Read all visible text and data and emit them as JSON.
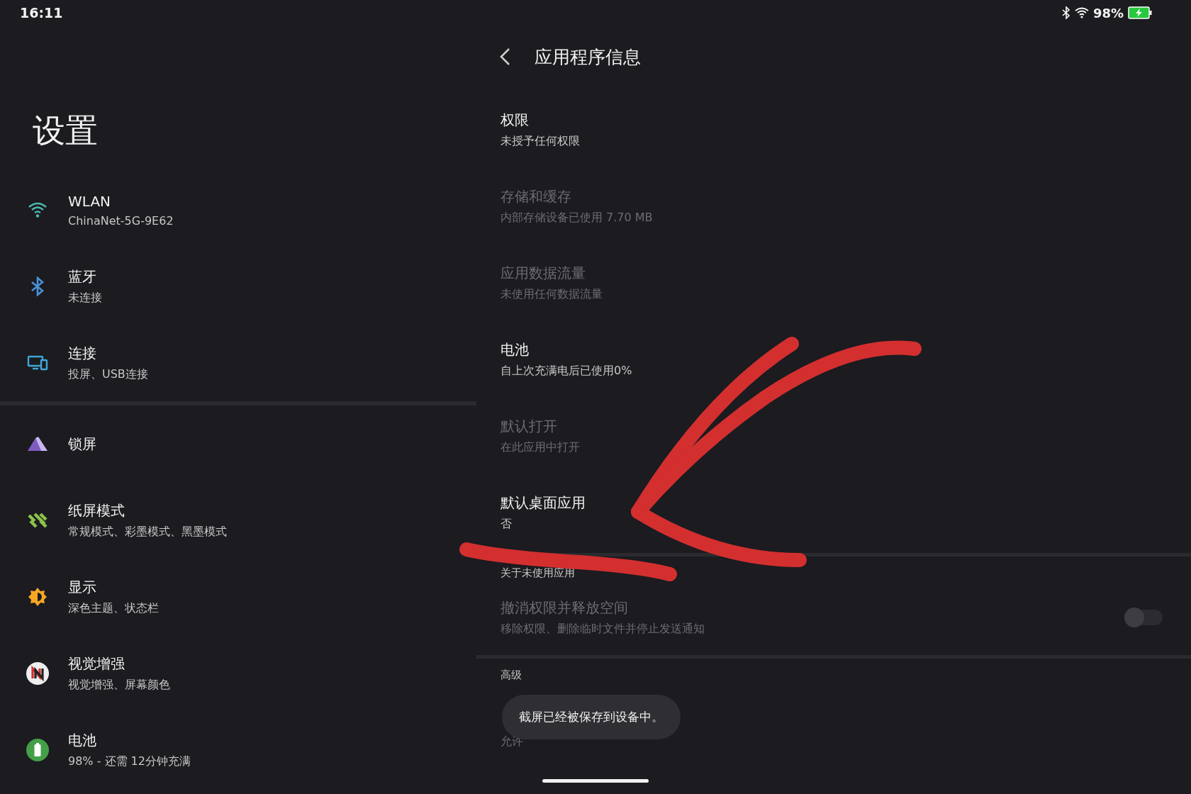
{
  "status_bar": {
    "time": "16:11",
    "battery_text": "98%"
  },
  "settings": {
    "title": "设置",
    "groups": [
      [
        {
          "kind": "wifi",
          "title": "WLAN",
          "subtitle": "ChinaNet-5G-9E62"
        },
        {
          "kind": "bluetooth",
          "title": "蓝牙",
          "subtitle": "未连接"
        },
        {
          "kind": "connection",
          "title": "连接",
          "subtitle": "投屏、USB连接"
        }
      ],
      [
        {
          "kind": "lock",
          "title": "锁屏"
        },
        {
          "kind": "paper",
          "title": "纸屏模式",
          "subtitle": "常规模式、彩墨模式、黑墨模式"
        },
        {
          "kind": "display",
          "title": "显示",
          "subtitle": "深色主题、状态栏"
        },
        {
          "kind": "vision",
          "title": "视觉增强",
          "subtitle": "视觉增强、屏幕颜色"
        },
        {
          "kind": "battery",
          "title": "电池",
          "subtitle": "98% - 还需 12分钟充满"
        }
      ]
    ]
  },
  "app_info": {
    "title": "应用程序信息",
    "items": [
      {
        "title": "权限",
        "subtitle": "未授予任何权限",
        "disabled": false
      },
      {
        "title": "存储和缓存",
        "subtitle": "内部存储设备已使用 7.70 MB",
        "disabled": true
      },
      {
        "title": "应用数据流量",
        "subtitle": "未使用任何数据流量",
        "disabled": true
      },
      {
        "title": "电池",
        "subtitle": "自上次充满电后已使用0%",
        "disabled": false
      },
      {
        "title": "默认打开",
        "subtitle": "在此应用中打开",
        "disabled": true
      },
      {
        "title": "默认桌面应用",
        "subtitle": "否",
        "disabled": false
      }
    ],
    "unused_section": {
      "header": "关于未使用应用",
      "toggle_title": "撤消权限并释放空间",
      "toggle_subtitle": "移除权限、删除临时文件并停止发送通知",
      "on": false,
      "disabled": true
    },
    "advanced_section": {
      "header": "高级",
      "item_subtitle": "允许"
    }
  },
  "toast": "截屏已经被保存到设备中。"
}
